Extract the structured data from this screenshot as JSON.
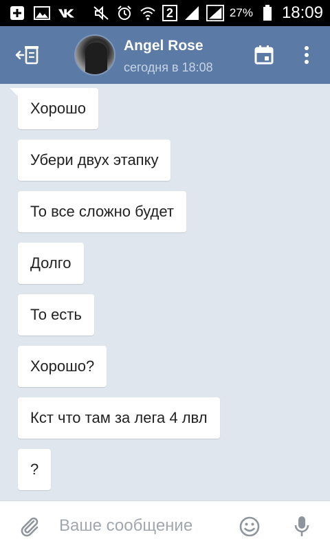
{
  "status_bar": {
    "left_icons": [
      "add-box-icon",
      "gallery-icon",
      "vk-icon"
    ],
    "right_icons": [
      "mute-icon",
      "alarm-icon",
      "wifi-icon",
      "sim-badge",
      "signal-icon",
      "signal-icon",
      "battery-icon"
    ],
    "sim_badge": "2",
    "battery": "27%",
    "time": "18:09"
  },
  "header": {
    "contact_name": "Angel Rose",
    "last_seen": "сегодня в 18:08",
    "back_icon": "back-arrow-icon",
    "calendar_icon": "calendar-icon",
    "more_icon": "more-vert-icon",
    "colors": {
      "header_bg": "#5b7ba6",
      "subtitle": "#c6d4e6"
    }
  },
  "messages": [
    {
      "text": "Хорошо"
    },
    {
      "text": "Убери двух этапку"
    },
    {
      "text": "То все сложно будет"
    },
    {
      "text": "Долго"
    },
    {
      "text": "То есть"
    },
    {
      "text": "Хорошо?"
    },
    {
      "text": "Кст что там за лега 4 лвл"
    },
    {
      "text": "?"
    }
  ],
  "composer": {
    "placeholder": "Ваше сообщение",
    "value": "",
    "attach_icon": "paperclip-icon",
    "emoji_icon": "emoji-icon",
    "mic_icon": "mic-icon"
  },
  "colors": {
    "chat_bg": "#dfe6ee",
    "bubble_bg": "#ffffff"
  }
}
